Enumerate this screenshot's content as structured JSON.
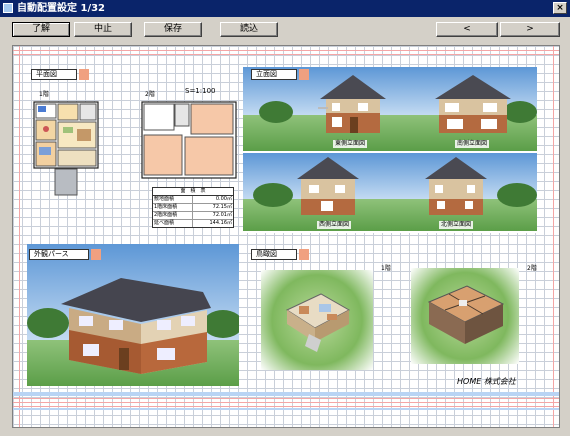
{
  "window": {
    "title": "自動配置設定 1/32",
    "close_label": "×"
  },
  "toolbar": {
    "ok_label": "了解",
    "cancel_label": "中止",
    "save_label": "保存",
    "load_label": "読込",
    "prev_label": "<",
    "next_label": ">"
  },
  "sheet": {
    "plan_panel": {
      "label": "平面図",
      "floor1": "1階",
      "floor2": "2階",
      "scale": "S=1:100",
      "area_table": {
        "header": "面　積　表",
        "rows": [
          {
            "label": "敷地面積",
            "value": "0.00㎡"
          },
          {
            "label": "1階床面積",
            "value": "72.15㎡"
          },
          {
            "label": "2階床面積",
            "value": "72.01㎡"
          },
          {
            "label": "延べ面積",
            "value": "144.16㎡"
          }
        ]
      }
    },
    "elevation_panel": {
      "label": "立面図",
      "views": [
        "東側立面図",
        "南側立面図",
        "西側立面図",
        "北側立面図"
      ]
    },
    "perspective_panel": {
      "label": "外観パース"
    },
    "bird_panel": {
      "label": "鳥瞰図",
      "floor1": "1階",
      "floor2": "2階"
    },
    "company": "HOME 株式会社"
  },
  "colors": {
    "titlebar": "#0a246a",
    "window_bg": "#d4d0c8",
    "grid_line": "#c9cfd9",
    "pink_line": "#f4a6a6",
    "label_tab": "#f0a080"
  }
}
